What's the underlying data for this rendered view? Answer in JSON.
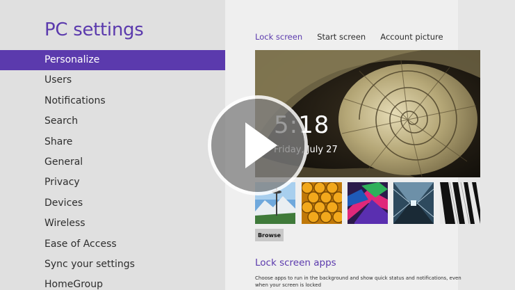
{
  "app_title": "PC settings",
  "nav": {
    "items": [
      {
        "label": "Personalize",
        "active": true
      },
      {
        "label": "Users"
      },
      {
        "label": "Notifications"
      },
      {
        "label": "Search"
      },
      {
        "label": "Share"
      },
      {
        "label": "General"
      },
      {
        "label": "Privacy"
      },
      {
        "label": "Devices"
      },
      {
        "label": "Wireless"
      },
      {
        "label": "Ease of Access"
      },
      {
        "label": "Sync your settings"
      },
      {
        "label": "HomeGroup"
      }
    ]
  },
  "tabs": [
    {
      "label": "Lock screen",
      "active": true
    },
    {
      "label": "Start screen"
    },
    {
      "label": "Account picture"
    }
  ],
  "lock_preview": {
    "time": "5:18",
    "date": "Friday, July 27"
  },
  "thumbnails": [
    "space-needle-mountain",
    "honeycomb",
    "color-ribbons",
    "light-tunnel",
    "piano-keys"
  ],
  "browse_label": "Browse",
  "lock_apps": {
    "title": "Lock screen apps",
    "description": "Choose apps to run in the background and show quick status and notifications, even when your screen is locked"
  },
  "overlay": {
    "icon": "play-icon"
  },
  "colors": {
    "accent": "#5b3aad",
    "left_pane": "#e0e0e0",
    "content_bg": "#efefef",
    "active_text": "#ffffff"
  }
}
